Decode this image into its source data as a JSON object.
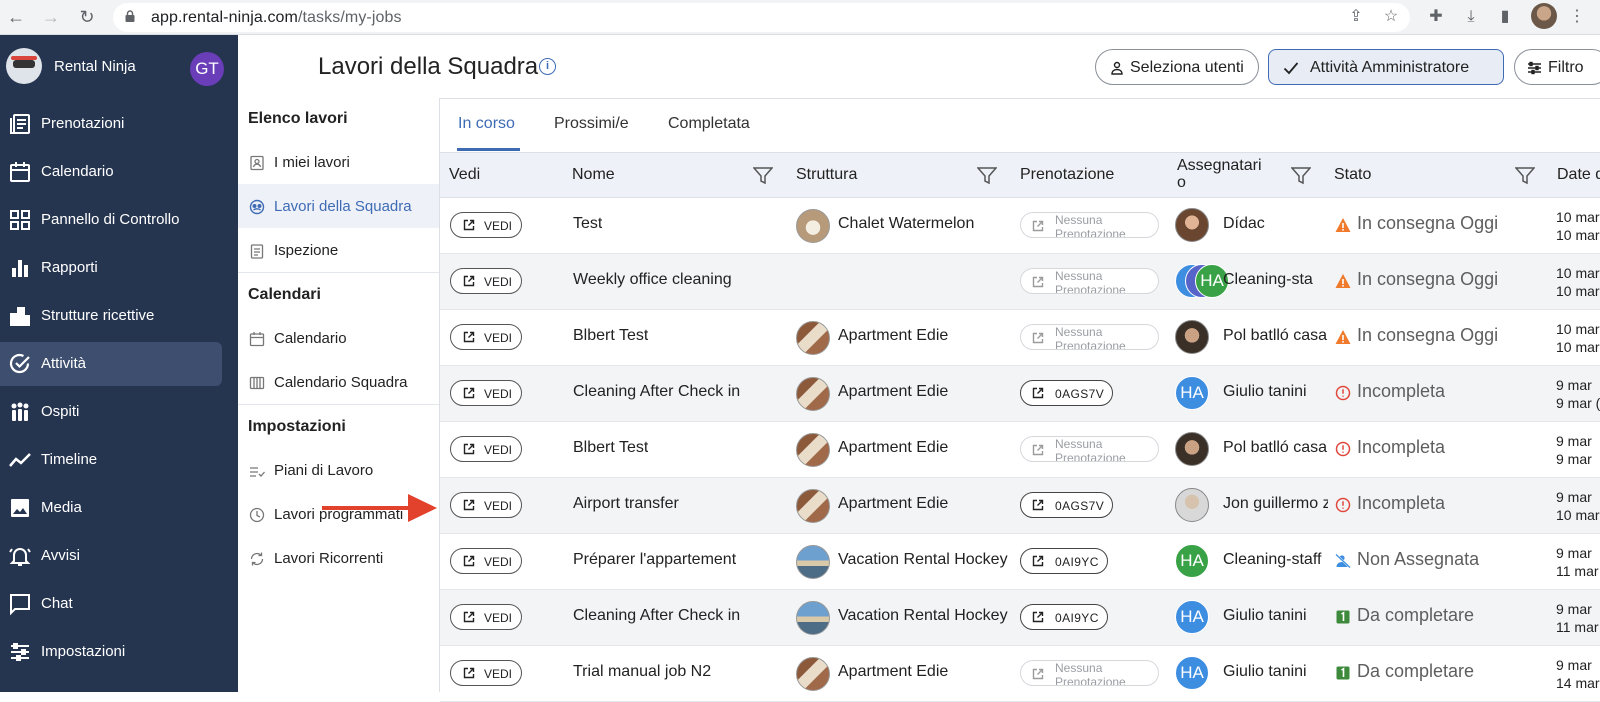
{
  "browser": {
    "url_host": "app.rental-ninja.com",
    "url_path": "/tasks/my-jobs"
  },
  "sidebar": {
    "brand": "Rental Ninja",
    "user_initials": "GT",
    "items": [
      {
        "label": "Prenotazioni",
        "icon": "bookings-icon"
      },
      {
        "label": "Calendario",
        "icon": "calendar-icon"
      },
      {
        "label": "Pannello di Controllo",
        "icon": "dashboard-icon"
      },
      {
        "label": "Rapporti",
        "icon": "bar-chart-icon"
      },
      {
        "label": "Strutture ricettive",
        "icon": "buildings-icon"
      },
      {
        "label": "Attività",
        "icon": "check-circle-icon",
        "active": true
      },
      {
        "label": "Ospiti",
        "icon": "guests-icon"
      },
      {
        "label": "Timeline",
        "icon": "timeline-icon"
      },
      {
        "label": "Media",
        "icon": "image-icon"
      },
      {
        "label": "Avvisi",
        "icon": "bell-icon"
      },
      {
        "label": "Chat",
        "icon": "chat-icon"
      },
      {
        "label": "Impostazioni",
        "icon": "sliders-icon"
      }
    ]
  },
  "submenu": {
    "section1": "Elenco lavori",
    "my_jobs": "I miei lavori",
    "team_jobs": "Lavori della Squadra",
    "inspection": "Ispezione",
    "section2": "Calendari",
    "calendar": "Calendario",
    "team_calendar": "Calendario Squadra",
    "section3": "Impostazioni",
    "work_plans": "Piani di Lavoro",
    "scheduled": "Lavori programmati",
    "recurring": "Lavori Ricorrenti"
  },
  "header": {
    "title": "Lavori della Squadra",
    "select_users": "Seleziona utenti",
    "admin_tasks": "Attività Amministratore",
    "filter": "Filtro"
  },
  "tabs": [
    "In corso",
    "Prossimi/e",
    "Completata"
  ],
  "table": {
    "columns": {
      "view": "Vedi",
      "name": "Nome",
      "property": "Struttura",
      "booking": "Prenotazione",
      "assignees": "Assegnatari",
      "assignees_cont": "o",
      "status": "Stato",
      "date": "Date d"
    },
    "view_label": "VEDI",
    "no_booking": "Nessuna Prenotazione",
    "rows": [
      {
        "name": "Test",
        "property": "Chalet Watermelon",
        "booking": "",
        "assignee": "Dídac",
        "status": "In consegna Oggi",
        "date1": "10 mar",
        "date2": "10 mar"
      },
      {
        "name": "Weekly office cleaning",
        "property": "",
        "booking": "",
        "assignee": "Cleaning-sta",
        "status": "In consegna Oggi",
        "date1": "10 mar",
        "date2": "10 mar",
        "avatar_initials": "HA"
      },
      {
        "name": "Blbert Test",
        "property": "Apartment Edie",
        "booking": "",
        "assignee": "Pol batlló casa",
        "status": "In consegna Oggi",
        "date1": "10 mar",
        "date2": "10 mar"
      },
      {
        "name": "Cleaning After Check in",
        "property": "Apartment Edie",
        "booking": "0AGS7V",
        "assignee": "Giulio tanini",
        "status": "Incompleta",
        "date1": "9 mar",
        "date2": "9 mar (",
        "avatar_initials": "HA"
      },
      {
        "name": "Blbert Test",
        "property": "Apartment Edie",
        "booking": "",
        "assignee": "Pol batlló casa",
        "status": "Incompleta",
        "date1": "9 mar",
        "date2": "9 mar"
      },
      {
        "name": "Airport transfer",
        "property": "Apartment Edie",
        "booking": "0AGS7V",
        "assignee": "Jon guillermo z",
        "status": "Incompleta",
        "date1": "9 mar",
        "date2": "10 mar"
      },
      {
        "name": "Préparer l'appartement",
        "property": "Vacation Rental Hockey",
        "booking": "0AI9YC",
        "assignee": "Cleaning-staff",
        "status": "Non Assegnata",
        "date1": "9 mar",
        "date2": "11 mar",
        "avatar_initials": "HA"
      },
      {
        "name": "Cleaning After Check in",
        "property": "Vacation Rental Hockey",
        "booking": "0AI9YC",
        "assignee": "Giulio tanini",
        "status": "Da completare",
        "date1": "9 mar",
        "date2": "11 mar",
        "avatar_initials": "HA"
      },
      {
        "name": "Trial manual job N2",
        "property": "Apartment Edie",
        "booking": "",
        "assignee": "Giulio tanini",
        "status": "Da completare",
        "date1": "9 mar",
        "date2": "14 mar",
        "avatar_initials": "HA"
      }
    ]
  },
  "colors": {
    "sidebar_bg": "#25344f",
    "accent": "#3f6bb5",
    "warning": "#f07a2b",
    "danger": "#e0473d",
    "success": "#3d8a3d",
    "annotation_arrow": "#e2412c"
  }
}
